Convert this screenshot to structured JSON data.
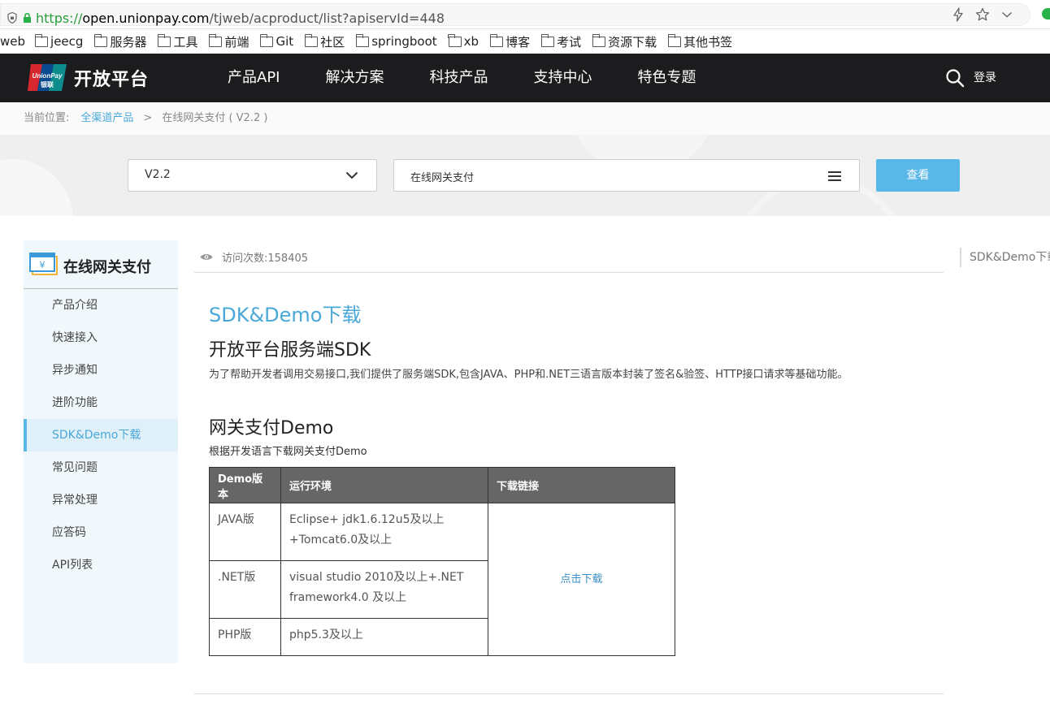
{
  "browser": {
    "url_scheme": "https://",
    "url_host": "open.unionpay.com",
    "url_path": "/tjweb/acproduct/list?apiservId=448"
  },
  "bookmarks": [
    "web",
    "jeecg",
    "服务器",
    "工具",
    "前端",
    "Git",
    "社区",
    "springboot",
    "xb",
    "博客",
    "考试",
    "资源下载",
    "其他书签"
  ],
  "header": {
    "logo_text": "开放平台",
    "nav": [
      "产品API",
      "解决方案",
      "科技产品",
      "支持中心",
      "特色专题"
    ],
    "login": "登录"
  },
  "breadcrumb": {
    "prefix": "当前位置:",
    "link": "全渠道产品",
    "separator": ">",
    "current": "在线网关支付 ( V2.2 )"
  },
  "filters": {
    "version": "V2.2",
    "product": "在线网关支付",
    "view_button": "查看"
  },
  "sidebar": {
    "title": "在线网关支付",
    "items": [
      "产品介绍",
      "快速接入",
      "异步通知",
      "进阶功能",
      "SDK&Demo下载",
      "常见问题",
      "异常处理",
      "应答码",
      "API列表"
    ],
    "active_index": 4
  },
  "content": {
    "visits": "访问次数:158405",
    "anchor": "SDK&Demo下载",
    "sdk_heading": "SDK&Demo下载",
    "server_heading": "开放平台服务端SDK",
    "server_desc": "为了帮助开发者调用交易接口,我们提供了服务端SDK,包含JAVA、PHP和.NET三语言版本封装了签名&验签、HTTP接口请求等基础功能。",
    "demo_heading": "网关支付Demo",
    "demo_desc": "根据开发语言下载网关支付Demo",
    "table": {
      "headers": [
        "Demo版本",
        "运行环境",
        "下载链接"
      ],
      "rows": [
        {
          "version": "JAVA版",
          "env_line1": "Eclipse+ jdk1.6.12u5及以上",
          "env_line2": "+Tomcat6.0及以上"
        },
        {
          "version": ".NET版",
          "env_line1": "visual studio   2010及以上+.NET",
          "env_line2": "framework4.0 及以上"
        },
        {
          "version": "PHP版",
          "env_line1": "php5.3及以上",
          "env_line2": ""
        }
      ],
      "download_label": "点击下载"
    }
  },
  "colors": {
    "accent": "#5ab8e8",
    "header_bg": "#1c1c1e",
    "table_header_bg": "#666666"
  }
}
